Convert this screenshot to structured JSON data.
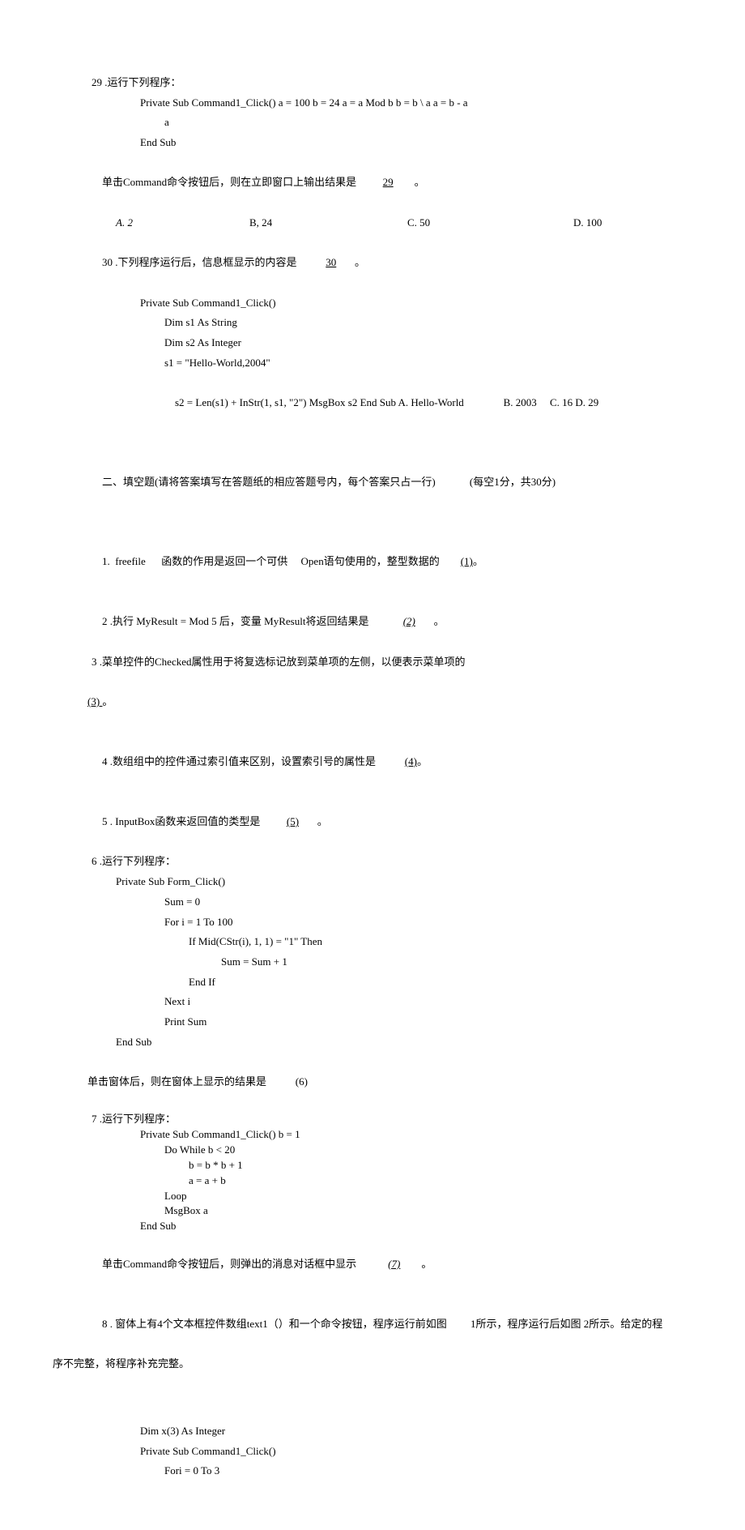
{
  "q29": {
    "title": "29 .运行下列程序：",
    "code1": "Private Sub Command1_Click() a = 100 b = 24 a = a Mod b b = b \\ a a = b - a",
    "code2": "a",
    "code3": "End Sub",
    "stem_pre": "单击Command命令按钮后，则在立即窗口上输出结果是",
    "blank": "29",
    "stem_post": "。",
    "choices": {
      "a": "A. 2",
      "b": "B, 24",
      "c": "C. 50",
      "d": "D. 100"
    }
  },
  "q30": {
    "title_pre": "30 .下列程序运行后，信息框显示的内容是",
    "blank": "30",
    "title_post": "。",
    "code1": "Private Sub Command1_Click()",
    "code2": "Dim s1 As String",
    "code3": "Dim s2 As Integer",
    "code4": "s1 = \"Hello-World,2004\"",
    "code5": "s2 = Len(s1) + InStr(1, s1, \"2\") MsgBox s2 End Sub A. Hello-World",
    "code5_b": "B. 2003",
    "code5_c": "C. 16",
    "code5_d": "D. 29"
  },
  "section2": {
    "title": "二、填空题(请将答案填写在答题纸的相应答题号内，每个答案只占一行)",
    "meta": "(每空1分，共30分)"
  },
  "b1": {
    "pre1": "1.  freefile",
    "pre2": "函数的作用是返回一个可供",
    "pre3": "Open语句使用的，整型数据的",
    "blank": "(1)",
    "post": "。"
  },
  "b2": {
    "pre": "2 .执行 MyResult = Mod 5 后，变量 MyResult将返回结果是",
    "blank": "(2)",
    "post": "。"
  },
  "b3": {
    "pre": "3 .菜单控件的Checked属性用于将复选标记放到菜单项的左侧，以便表示菜单项的",
    "blank": "(3) ",
    "post": "。"
  },
  "b4": {
    "pre": "4 .数组组中的控件通过索引值来区别，设置索引号的属性是",
    "blank": "(4)",
    "post": "。"
  },
  "b5": {
    "pre": "5 . InputBox函数来返回值的类型是",
    "blank": "(5)",
    "post": "。"
  },
  "b6": {
    "title": "6 .运行下列程序：",
    "code1": "Private Sub Form_Click()",
    "code2": "Sum = 0",
    "code3": "For i = 1 To 100",
    "code4": "If Mid(CStr(i), 1, 1) = \"1\" Then",
    "code5": "Sum = Sum + 1",
    "code6": "End If",
    "code7": "Next i",
    "code8": "Print Sum",
    "code9": "End Sub",
    "stem_pre": "单击窗体后，则在窗体上显示的结果是",
    "stem_blank": "(6)"
  },
  "b7": {
    "title": "7 .运行下列程序：",
    "code1": "Private Sub Command1_Click() b = 1",
    "code2": "Do While b < 20",
    "code3": "b = b * b + 1",
    "code4": "a = a + b",
    "code5": "Loop",
    "code6": "MsgBox a",
    "code7": "End Sub",
    "stem_pre": "单击Command命令按钮后，则弹出的消息对话框中显示",
    "stem_blank": "(7)",
    "stem_post": "。"
  },
  "b8": {
    "line1": "8 . 窗体上有4个文本框控件数组text1（）和一个命令按钮，程序运行前如图",
    "line1_b": "1所示，程序运行后如图 2所示。给定的程",
    "line2": "序不完整，将程序补充完整。",
    "code1": "Dim x(3) As Integer",
    "code2": "Private Sub Command1_Click()",
    "code3": "Fori = 0 To 3"
  }
}
